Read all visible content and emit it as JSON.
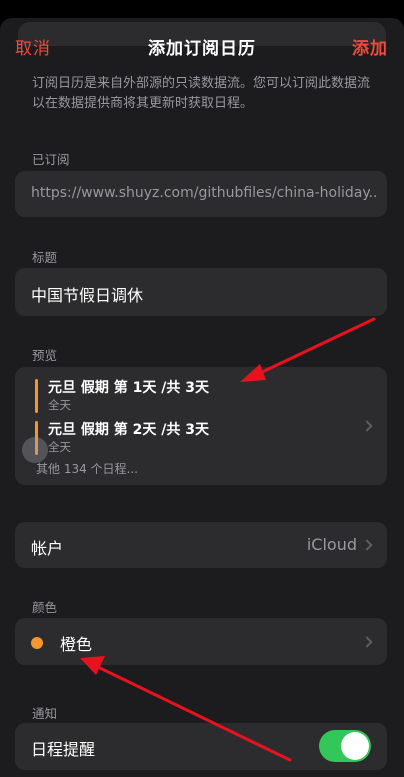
{
  "nav": {
    "cancel_label": "取消",
    "title": "添加订阅日历",
    "add_label": "添加"
  },
  "description": "订阅日历是来自外部源的只读数据流。您可以订阅此数据流以在数据提供商将其更新时获取日程。",
  "subscribed": {
    "label": "已订阅",
    "url": "https://www.shuyz.com/githubfiles/china-holiday..."
  },
  "title_section": {
    "label": "标题",
    "value": "中国节假日调休"
  },
  "preview": {
    "label": "预览",
    "events": [
      {
        "title": "元旦 假期 第 1天 /共 3天",
        "subtitle": "全天"
      },
      {
        "title": "元旦 假期 第 2天 /共 3天",
        "subtitle": "全天"
      }
    ],
    "more": "其他 134 个日程..."
  },
  "account": {
    "label": "帐户",
    "value": "iCloud"
  },
  "color": {
    "label": "颜色",
    "value": "橙色",
    "swatch": "#f5952d"
  },
  "notification": {
    "label": "通知",
    "row_label": "日程提醒",
    "enabled": true
  },
  "colors": {
    "accent_red": "#ef4a3c",
    "toggle_on": "#33c759",
    "annotation_arrow": "#e8121e"
  }
}
